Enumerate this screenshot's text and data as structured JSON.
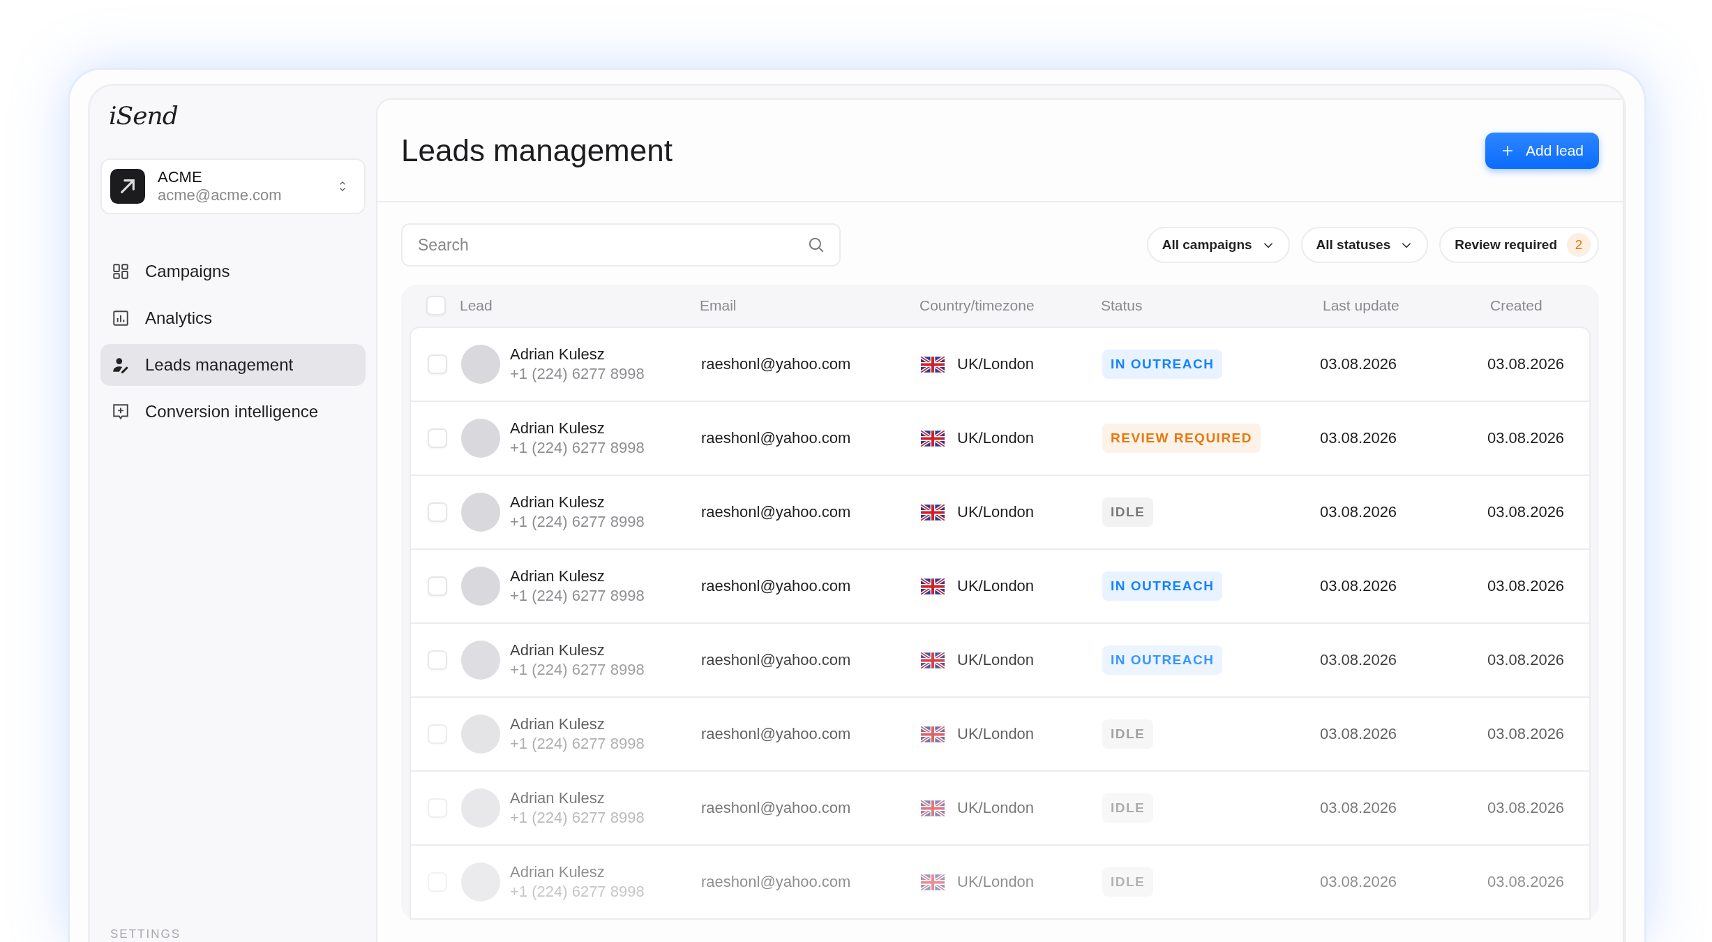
{
  "app": {
    "logo": "iSend"
  },
  "account": {
    "name": "ACME",
    "email": "acme@acme.com"
  },
  "sidebar": {
    "items": [
      {
        "label": "Campaigns",
        "selected": false
      },
      {
        "label": "Analytics",
        "selected": false
      },
      {
        "label": "Leads management",
        "selected": true
      },
      {
        "label": "Conversion intelligence",
        "selected": false
      }
    ],
    "section_label": "SETTINGS"
  },
  "page": {
    "title": "Leads management",
    "add_button": "Add lead"
  },
  "search": {
    "placeholder": "Search"
  },
  "filters": [
    {
      "label": "All campaigns",
      "kind": "dropdown"
    },
    {
      "label": "All statuses",
      "kind": "dropdown"
    },
    {
      "label": "Review required",
      "kind": "count",
      "count": "2"
    }
  ],
  "table": {
    "header_checked": false,
    "columns": [
      "Lead",
      "Email",
      "Country/timezone",
      "Status",
      "Last update",
      "Created"
    ],
    "rows": [
      {
        "checked": false,
        "name": "Adrian Kulesz",
        "phone": "+1 (224) 6277 8998",
        "email": "raeshonl@yahoo.com",
        "country": "UK/London",
        "status": {
          "text": "IN OUTREACH",
          "color": "#1583ff"
        },
        "last_update": "03.08.2026",
        "created": "03.08.2026"
      },
      {
        "checked": false,
        "name": "Adrian Kulesz",
        "phone": "+1 (224) 6277 8998",
        "email": "raeshonl@yahoo.com",
        "country": "UK/London",
        "status": {
          "text": "REVIEW REQUIRED",
          "color": "#e6780e"
        },
        "last_update": "03.08.2026",
        "created": "03.08.2026"
      },
      {
        "checked": false,
        "name": "Adrian Kulesz",
        "phone": "+1 (224) 6277 8998",
        "email": "raeshonl@yahoo.com",
        "country": "UK/London",
        "status": {
          "text": "IDLE",
          "color": "#7a7a7e"
        },
        "last_update": "03.08.2026",
        "created": "03.08.2026"
      },
      {
        "checked": false,
        "name": "Adrian Kulesz",
        "phone": "+1 (224) 6277 8998",
        "email": "raeshonl@yahoo.com",
        "country": "UK/London",
        "status": {
          "text": "IN OUTREACH",
          "color": "#1583ff"
        },
        "last_update": "03.08.2026",
        "created": "03.08.2026"
      },
      {
        "checked": false,
        "name": "Adrian Kulesz",
        "phone": "+1 (224) 6277 8998",
        "email": "raeshonl@yahoo.com",
        "country": "UK/London",
        "status": {
          "text": "IN OUTREACH",
          "color": "#3895ff"
        },
        "last_update": "03.08.2026",
        "created": "03.08.2026"
      },
      {
        "checked": false,
        "name": "Adrian Kulesz",
        "phone": "+1 (224) 6277 8998",
        "email": "raeshonl@yahoo.com",
        "country": "UK/London",
        "status": {
          "text": "IDLE",
          "color": "#a2a2a5"
        },
        "last_update": "03.08.2026",
        "created": "03.08.2026"
      },
      {
        "checked": false,
        "name": "Adrian Kulesz",
        "phone": "+1 (224) 6277 8998",
        "email": "raeshonl@yahoo.com",
        "country": "UK/London",
        "status": {
          "text": "IDLE",
          "color": "#acacaf"
        },
        "last_update": "03.08.2026",
        "created": "03.08.2026"
      },
      {
        "checked": false,
        "name": "Adrian Kulesz",
        "phone": "+1 (224) 6277 8998",
        "email": "raeshonl@yahoo.com",
        "country": "UK/London",
        "status": {
          "text": "IDLE",
          "color": "#b3b3b6"
        },
        "last_update": "03.08.2026",
        "created": "03.08.2026"
      }
    ]
  }
}
